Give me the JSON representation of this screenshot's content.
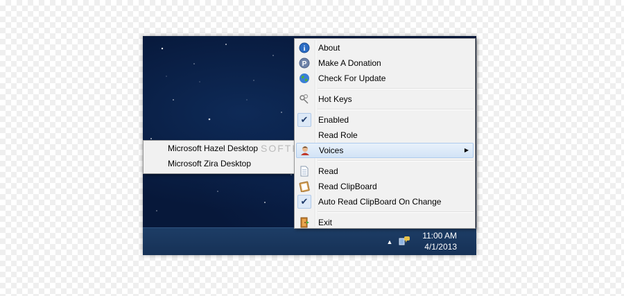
{
  "menu": {
    "items": [
      {
        "label": "About",
        "icon": "info-icon"
      },
      {
        "label": "Make A Donation",
        "icon": "paypal-icon"
      },
      {
        "label": "Check For Update",
        "icon": "globe-icon"
      },
      {
        "label": "Hot Keys",
        "icon": "keys-icon"
      },
      {
        "label": "Enabled",
        "checked": true
      },
      {
        "label": "Read Role",
        "checked": false
      },
      {
        "label": "Voices",
        "icon": "voices-icon",
        "has_submenu": true,
        "highlighted": true
      },
      {
        "label": "Read",
        "icon": "document-icon"
      },
      {
        "label": "Read ClipBoard",
        "icon": "clipboard-icon"
      },
      {
        "label": "Auto Read ClipBoard On Change",
        "checked": true
      },
      {
        "label": "Exit",
        "icon": "exit-door-icon"
      }
    ]
  },
  "submenu": {
    "voices": [
      "Microsoft Hazel Desktop",
      "Microsoft Zira Desktop"
    ]
  },
  "taskbar": {
    "time": "11:00 AM",
    "date": "4/1/2013"
  },
  "watermark": "SOFTPEDIA",
  "colors": {
    "desktop": "#07183a",
    "taskbar": "#1d3d66",
    "menu_bg": "#f1f1f1",
    "highlight": "#d2e3f6"
  }
}
